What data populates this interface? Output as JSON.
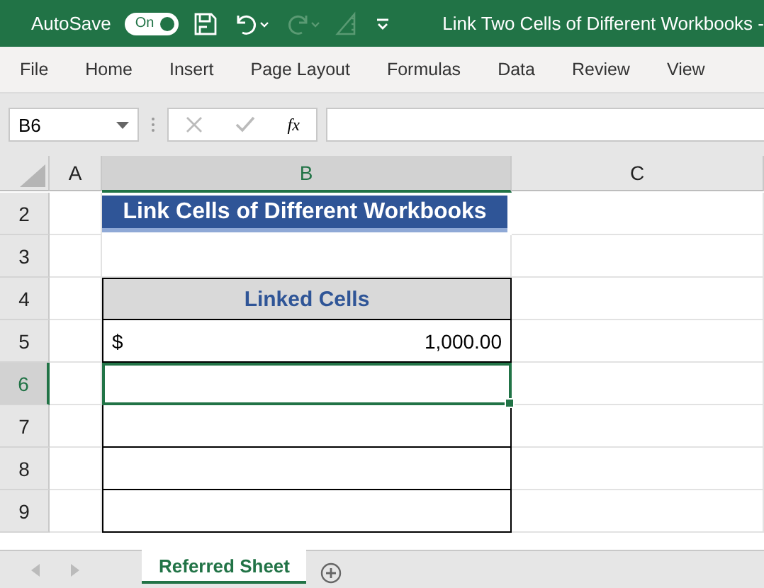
{
  "title_bar": {
    "autosave_label": "AutoSave",
    "autosave_toggle": {
      "label": "On",
      "on": true
    },
    "title": "Link Two Cells of Different Workbooks -"
  },
  "ribbon": {
    "tabs": [
      "File",
      "Home",
      "Insert",
      "Page Layout",
      "Formulas",
      "Data",
      "Review",
      "View"
    ]
  },
  "formula_bar": {
    "name_box": "B6",
    "function_label": "fx"
  },
  "columns": [
    {
      "label": "A",
      "selected": false
    },
    {
      "label": "B",
      "selected": true
    },
    {
      "label": "C",
      "selected": false
    }
  ],
  "rows": [
    {
      "number": "2",
      "selected": false,
      "cell": {
        "kind": "title",
        "text": "Link Cells of Different Workbooks"
      }
    },
    {
      "number": "3",
      "selected": false,
      "cell": {
        "kind": "blank"
      }
    },
    {
      "number": "4",
      "selected": false,
      "cell": {
        "kind": "header",
        "text": "Linked Cells"
      }
    },
    {
      "number": "5",
      "selected": false,
      "cell": {
        "kind": "amount",
        "currency": "$",
        "text": "1,000.00"
      }
    },
    {
      "number": "6",
      "selected": true,
      "cell": {
        "kind": "boxed"
      }
    },
    {
      "number": "7",
      "selected": false,
      "cell": {
        "kind": "boxed"
      }
    },
    {
      "number": "8",
      "selected": false,
      "cell": {
        "kind": "boxed"
      }
    },
    {
      "number": "9",
      "selected": false,
      "cell": {
        "kind": "boxed"
      }
    }
  ],
  "sheet_tabs": [
    {
      "label": "Referred Sheet",
      "selected": true
    }
  ]
}
